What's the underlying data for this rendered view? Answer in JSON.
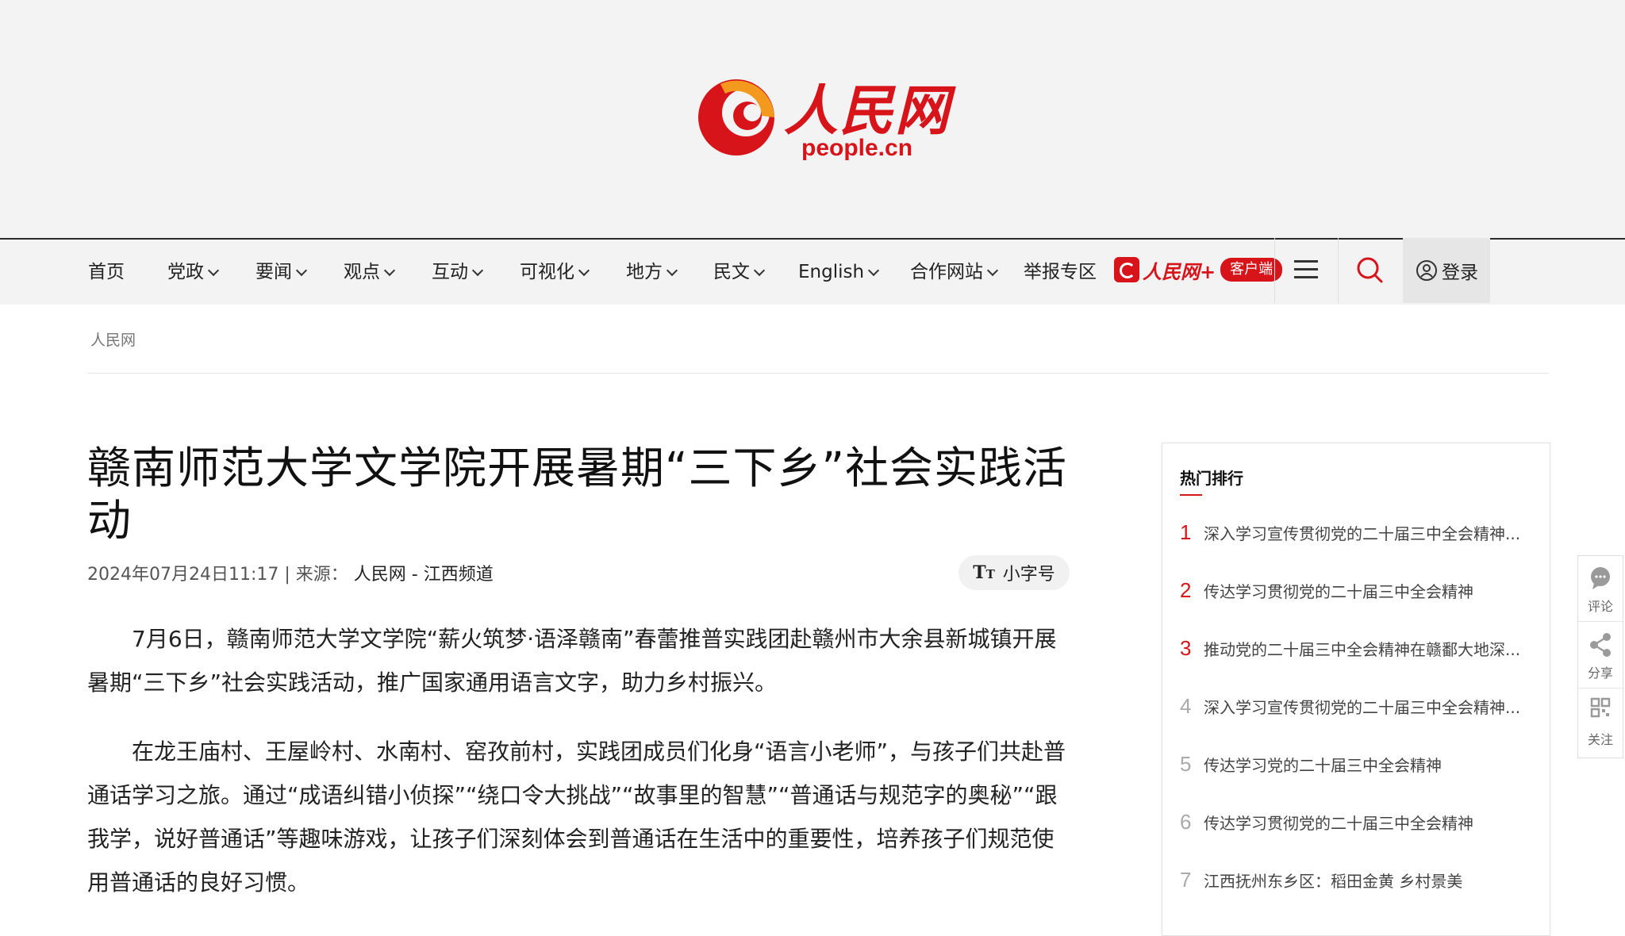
{
  "logo": {
    "cn": "人民网",
    "en": "people.cn"
  },
  "nav": {
    "items": [
      {
        "label": "首页",
        "dropdown": false
      },
      {
        "label": "党政",
        "dropdown": true
      },
      {
        "label": "要闻",
        "dropdown": true
      },
      {
        "label": "观点",
        "dropdown": true
      },
      {
        "label": "互动",
        "dropdown": true
      },
      {
        "label": "可视化",
        "dropdown": true
      },
      {
        "label": "地方",
        "dropdown": true
      },
      {
        "label": "民文",
        "dropdown": true
      },
      {
        "label": "English",
        "dropdown": true
      },
      {
        "label": "合作网站",
        "dropdown": true
      },
      {
        "label": "举报专区",
        "dropdown": false
      }
    ],
    "app_name": "人民网+",
    "app_pill": "客户端",
    "login_label": "登录",
    "icons": {
      "menu": "menu-icon",
      "search": "search-icon",
      "user": "user-icon"
    }
  },
  "breadcrumb": "人民网",
  "article": {
    "title": "赣南师范大学文学院开展暑期“三下乡”社会实践活动",
    "datetime": "2024年07月24日11:17",
    "source_prefix": "| 来源：",
    "source": "人民网 - 江西频道",
    "font_toggle": "小字号",
    "paragraphs": [
      "7月6日，赣南师范大学文学院“薪火筑梦·语泽赣南”春蕾推普实践团赴赣州市大余县新城镇开展暑期“三下乡”社会实践活动，推广国家通用语言文字，助力乡村振兴。",
      "在龙王庙村、王屋岭村、水南村、窑孜前村，实践团成员们化身“语言小老师”，与孩子们共赴普通话学习之旅。通过“成语纠错小侦探”“绕口令大挑战”“故事里的智慧”“普通话与规范字的奥秘”“跟我学，说好普通话”等趣味游戏，让孩子们深刻体会到普通话在生活中的重要性，培养孩子们规范使用普通话的良好习惯。"
    ]
  },
  "sidebar": {
    "title": "热门排行",
    "items": [
      {
        "rank": "1",
        "text": "深入学习宣传贯彻党的二十届三中全会精神..."
      },
      {
        "rank": "2",
        "text": "传达学习贯彻党的二十届三中全会精神"
      },
      {
        "rank": "3",
        "text": "推动党的二十届三中全会精神在赣鄱大地深..."
      },
      {
        "rank": "4",
        "text": "深入学习宣传贯彻党的二十届三中全会精神..."
      },
      {
        "rank": "5",
        "text": "传达学习党的二十届三中全会精神"
      },
      {
        "rank": "6",
        "text": "传达学习贯彻党的二十届三中全会精神"
      },
      {
        "rank": "7",
        "text": "江西抚州东乡区：稻田金黄 乡村景美"
      }
    ]
  },
  "float": {
    "comment": "评论",
    "share": "分享",
    "follow": "关注"
  },
  "colors": {
    "brand_red": "#d7141a",
    "accent_orange": "#f39a1e",
    "nav_bg": "#f3f3f3"
  }
}
